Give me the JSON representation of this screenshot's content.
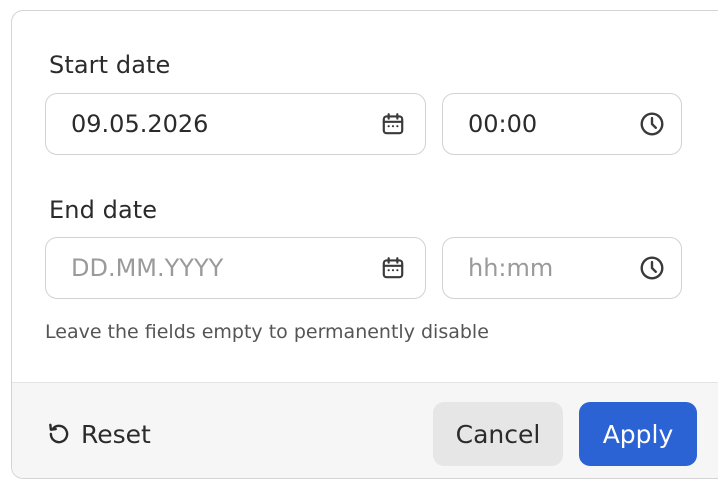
{
  "start": {
    "label": "Start date",
    "date_value": "09.05.2026",
    "date_placeholder": "DD.MM.YYYY",
    "time_value": "00:00",
    "time_placeholder": "hh:mm"
  },
  "end": {
    "label": "End date",
    "date_value": "",
    "date_placeholder": "DD.MM.YYYY",
    "time_value": "",
    "time_placeholder": "hh:mm"
  },
  "hint": "Leave the fields empty to permanently disable",
  "footer": {
    "reset_label": "Reset",
    "cancel_label": "Cancel",
    "apply_label": "Apply"
  },
  "icons": {
    "calendar": "calendar-icon",
    "clock": "clock-icon",
    "reset": "reset-icon"
  },
  "colors": {
    "accent": "#2b63d4",
    "icon": "#3a3a3a",
    "placeholder": "#9a9a9a"
  }
}
